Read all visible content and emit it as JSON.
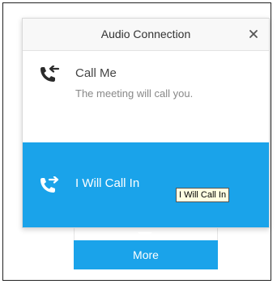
{
  "dialog": {
    "title": "Audio Connection",
    "close_icon": "close-icon"
  },
  "options": [
    {
      "label": "Call Me",
      "description": "The meeting will call you.",
      "icon": "incoming-call-icon",
      "selected": false
    },
    {
      "label": "I Will Call In",
      "icon": "outgoing-call-icon",
      "selected": true
    }
  ],
  "tooltip": {
    "text": "I Will Call In"
  },
  "more_button": {
    "label": "More"
  },
  "colors": {
    "accent": "#1aa3ea",
    "header_bg": "#f8f8f8",
    "text_primary": "#444444",
    "text_secondary": "#888888",
    "tooltip_bg": "#ffffe1"
  }
}
